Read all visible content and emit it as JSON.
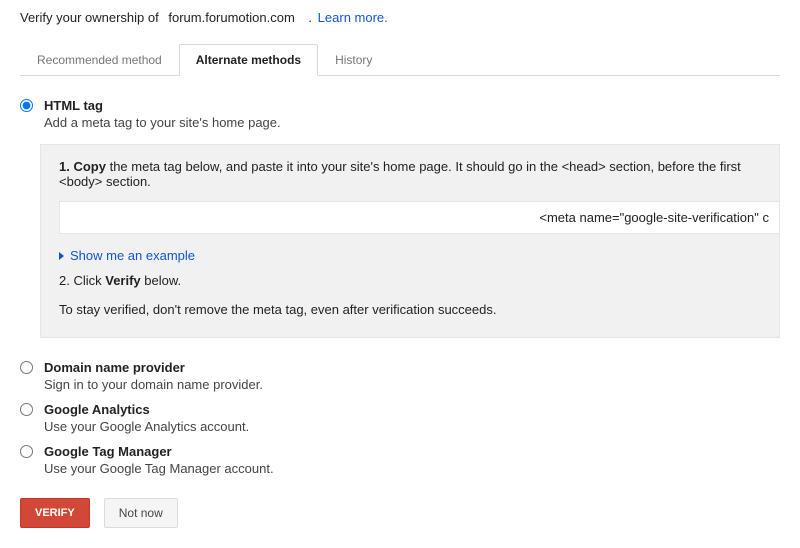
{
  "header": {
    "verify_text": "Verify your ownership of",
    "domain": "forum.forumotion.com",
    "dot": ".",
    "learn_more": "Learn more."
  },
  "tabs": {
    "recommended": "Recommended method",
    "alternate": "Alternate methods",
    "history": "History"
  },
  "options": {
    "html_tag": {
      "title": "HTML tag",
      "desc": "Add a meta tag to your site's home page."
    },
    "domain_provider": {
      "title": "Domain name provider",
      "desc": "Sign in to your domain name provider."
    },
    "analytics": {
      "title": "Google Analytics",
      "desc": "Use your Google Analytics account."
    },
    "tag_manager": {
      "title": "Google Tag Manager",
      "desc": "Use your Google Tag Manager account."
    }
  },
  "instructions": {
    "step1_prefix": "1. Copy",
    "step1_rest": " the meta tag below, and paste it into your site's home page. It should go in the <head> section, before the first <body> section.",
    "meta_tag": "<meta name=\"google-site-verification\" c",
    "example_link": "Show me an example",
    "step2_prefix": "2. Click ",
    "step2_verify": "Verify",
    "step2_suffix": " below.",
    "stay_verified": "To stay verified, don't remove the meta tag, even after verification succeeds."
  },
  "buttons": {
    "verify": "VERIFY",
    "not_now": "Not now"
  }
}
